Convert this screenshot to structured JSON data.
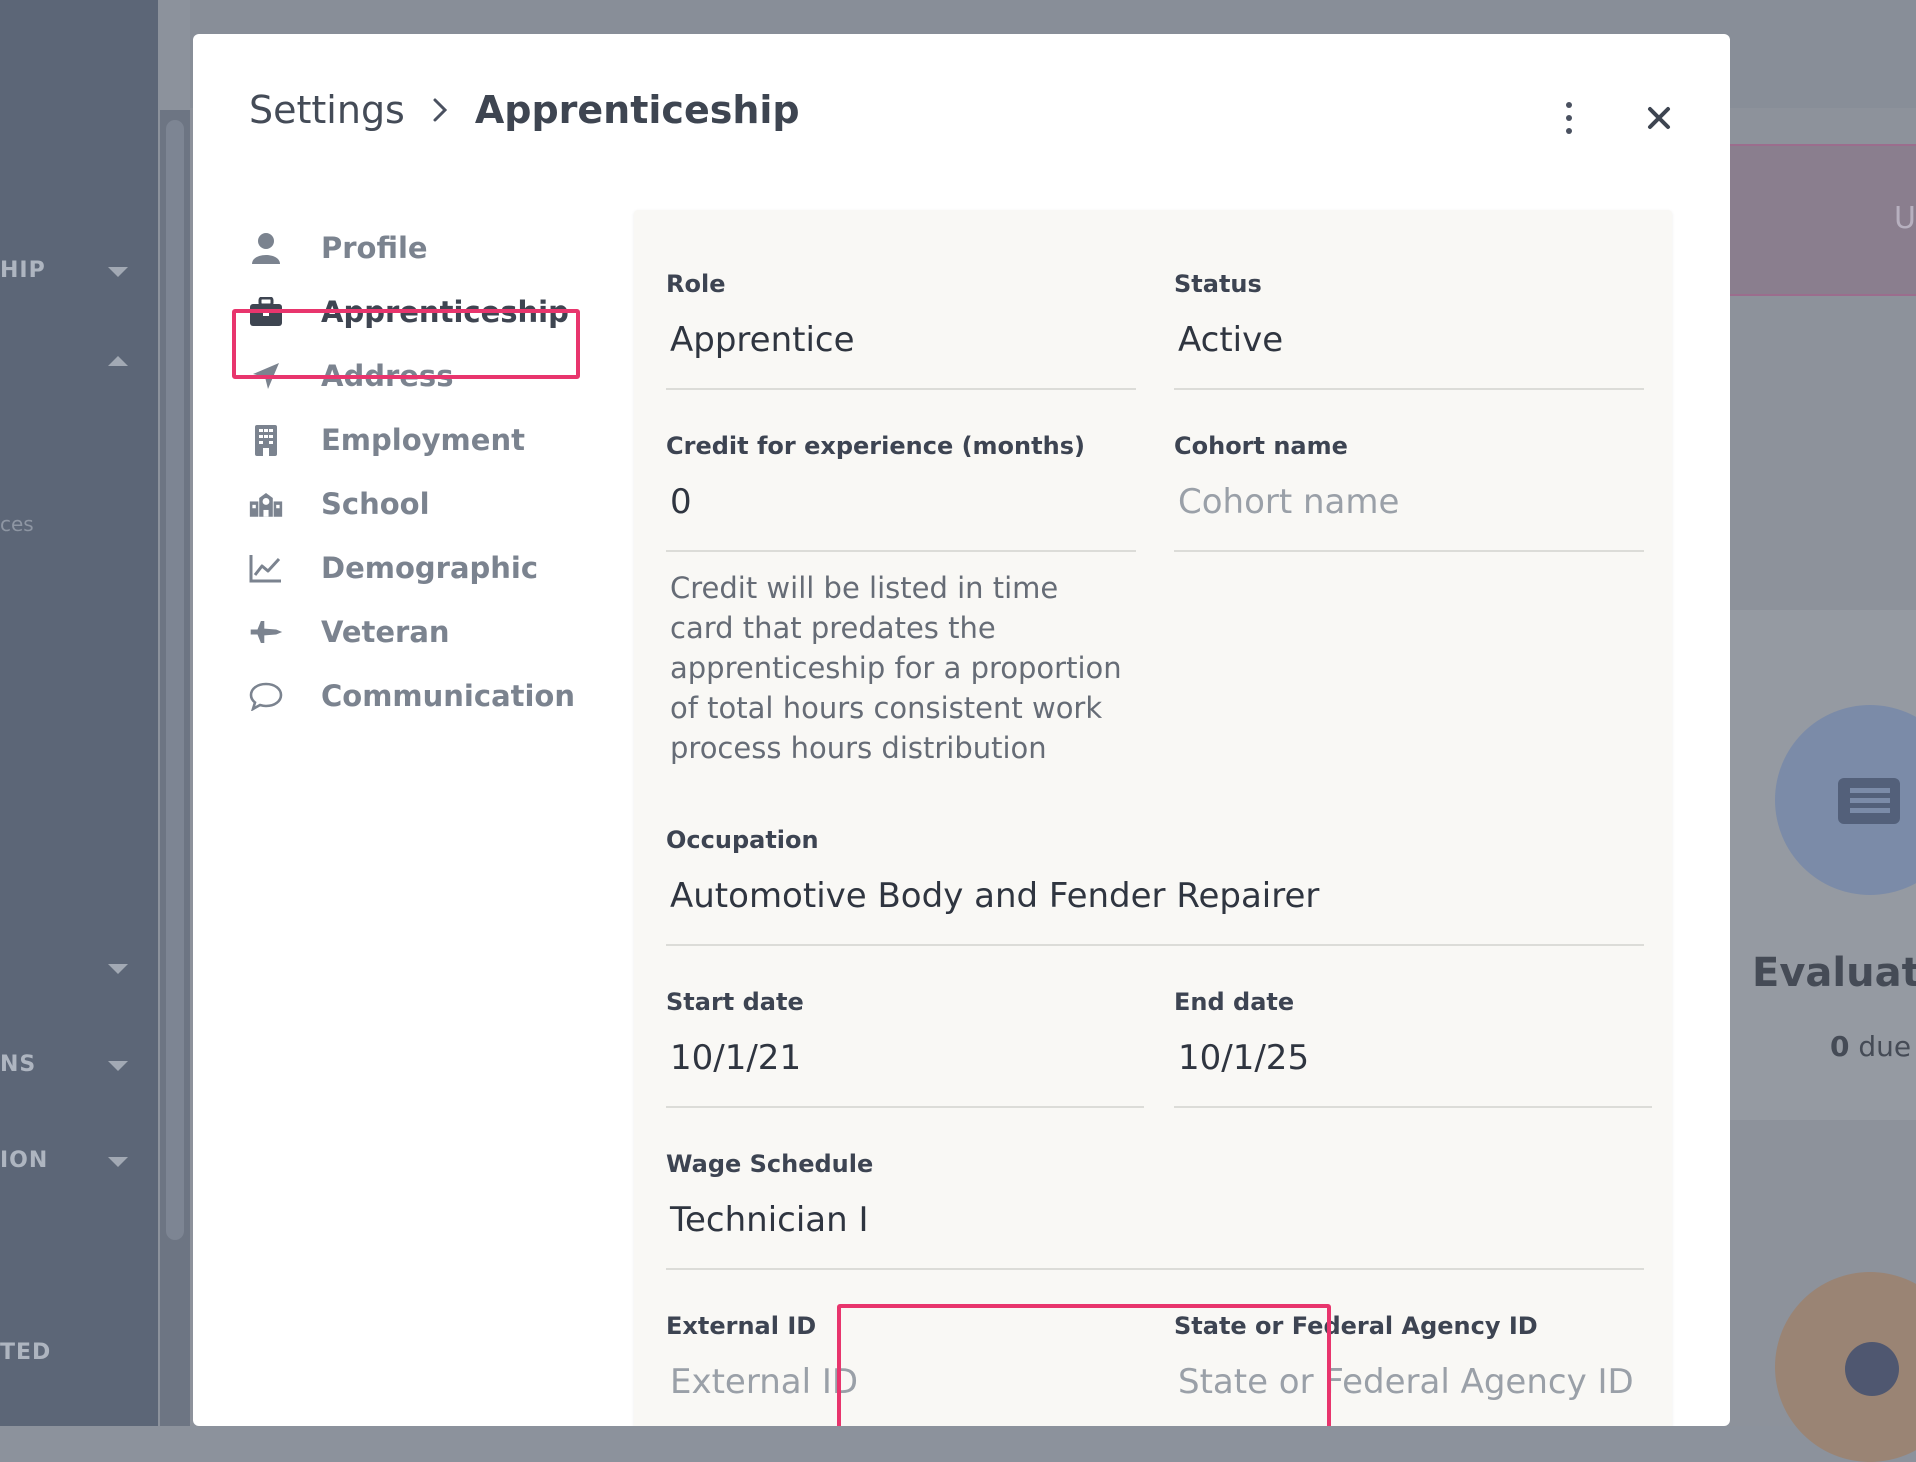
{
  "background": {
    "sidebar_labels": [
      "HIP",
      "ces",
      "NS",
      "ION",
      "TED"
    ],
    "banner_text": "U",
    "card_title": "Evaluati",
    "card_count": "0",
    "card_count_suffix": "due"
  },
  "modal": {
    "breadcrumb": {
      "root": "Settings",
      "separator": "›",
      "current": "Apprenticeship"
    },
    "actions": {
      "more_icon": "vertical-dots-icon",
      "close_icon": "close-icon"
    }
  },
  "nav": {
    "items": [
      {
        "label": "Profile",
        "icon": "person-icon"
      },
      {
        "label": "Apprenticeship",
        "icon": "briefcase-icon",
        "active": true
      },
      {
        "label": "Address",
        "icon": "location-arrow-icon"
      },
      {
        "label": "Employment",
        "icon": "building-icon"
      },
      {
        "label": "School",
        "icon": "school-icon"
      },
      {
        "label": "Demographic",
        "icon": "line-chart-icon"
      },
      {
        "label": "Veteran",
        "icon": "fighter-jet-icon"
      },
      {
        "label": "Communication",
        "icon": "speech-bubble-icon"
      }
    ]
  },
  "form": {
    "role": {
      "label": "Role",
      "value": "Apprentice"
    },
    "status": {
      "label": "Status",
      "value": "Active"
    },
    "credit": {
      "label": "Credit for experience (months)",
      "value": "0",
      "helper": "Credit will be listed in time card that predates the apprenticeship for a proportion of total hours consistent work process hours distribution"
    },
    "cohort": {
      "label": "Cohort name",
      "placeholder": "Cohort name"
    },
    "occupation": {
      "label": "Occupation",
      "value": "Automotive Body and Fender Repairer"
    },
    "start_date": {
      "label": "Start date",
      "value": "10/1/21"
    },
    "end_date": {
      "label": "End date",
      "value": "10/1/25"
    },
    "wage_schedule": {
      "label": "Wage Schedule",
      "value": "Technician I"
    },
    "external_id": {
      "label": "External ID",
      "placeholder": "External ID"
    },
    "agency_id": {
      "label": "State or Federal Agency ID",
      "placeholder": "State or Federal Agency ID"
    }
  },
  "colors": {
    "highlight": "#e8356d",
    "panel_bg": "#f9f8f5",
    "active_text": "#3e4551",
    "muted_text": "#7b838f"
  }
}
